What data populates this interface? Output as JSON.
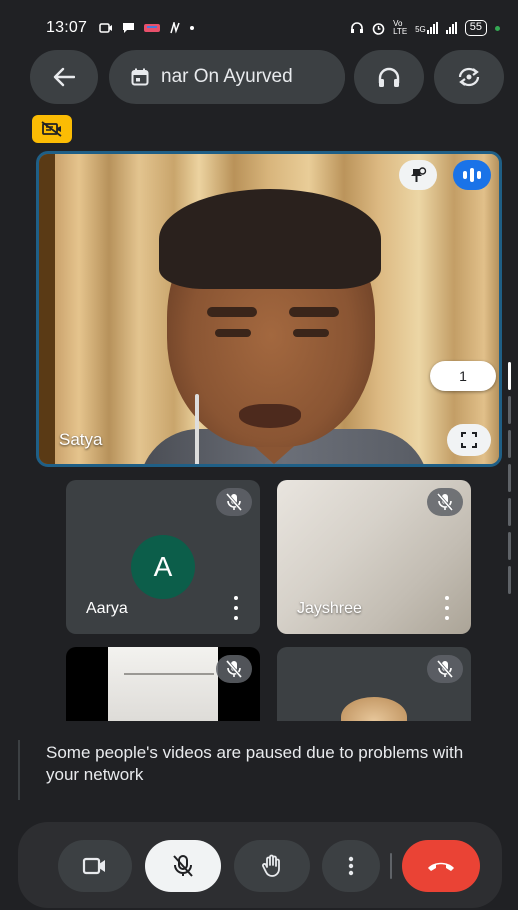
{
  "status_bar": {
    "time": "13:07",
    "network": "Vo LTE",
    "signal": "5G",
    "battery": "55"
  },
  "meeting": {
    "title": "nar On Ayurved"
  },
  "main_tile": {
    "name": "Satya"
  },
  "page_indicator": {
    "label": "1"
  },
  "participants": [
    {
      "name": "Aarya",
      "initial": "A",
      "muted": true
    },
    {
      "name": "Jayshree",
      "muted": true
    },
    {
      "name": "",
      "muted": true
    },
    {
      "name": "",
      "muted": true
    }
  ],
  "notice": {
    "text": "Some people's videos are paused due to problems with your network"
  },
  "colors": {
    "background": "#202124",
    "surface": "#3c4043",
    "end_call": "#ea4335",
    "speaking": "#1a73e8",
    "badge": "#fbbc04",
    "avatar": "#0c5e4a"
  },
  "icons": {
    "back": "arrow-left-icon",
    "calendar": "calendar-icon",
    "audio": "headphones-icon",
    "switch_camera": "switch-camera-icon",
    "no_video_badge": "video-off-icon",
    "pin": "pin-icon",
    "speaking": "audio-level-icon",
    "fullscreen": "fullscreen-icon",
    "muted": "mic-off-icon",
    "camera": "video-camera-icon",
    "raise_hand": "raise-hand-icon",
    "more": "more-vert-icon",
    "end_call": "call-end-icon"
  }
}
